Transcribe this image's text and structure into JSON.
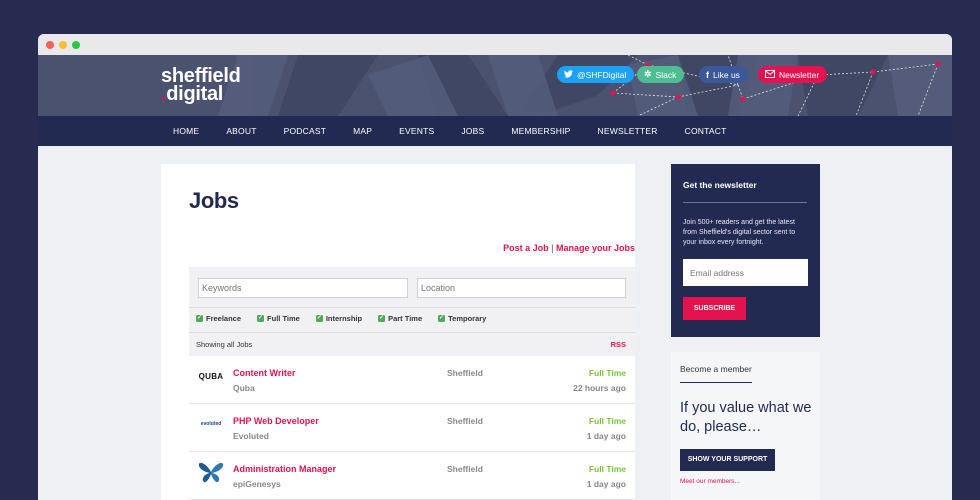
{
  "colors": {
    "navy": "#232a52",
    "brand_red": "#e4134f",
    "twitter_blue": "#1da1f2",
    "slack_green": "#4ebe92",
    "facebook_blue": "#3b5998",
    "full_time_green": "#78c432",
    "checkbox_green": "#52a95a"
  },
  "window_controls": [
    {
      "name": "close",
      "color": "#ff5f57"
    },
    {
      "name": "minimize",
      "color": "#febc2e"
    },
    {
      "name": "maximize",
      "color": "#28c840"
    }
  ],
  "header": {
    "logo_line1": "sheffield",
    "logo_dot": ".",
    "logo_line2": "digital",
    "social": {
      "twitter": {
        "icon": "twitter-bird-icon",
        "label": "@SHFDigital"
      },
      "slack": {
        "icon": "slack-icon",
        "label": "Slack"
      },
      "facebook": {
        "icon": "facebook-icon",
        "label": "Like us"
      },
      "newsletter": {
        "icon": "mail-icon",
        "label": "Newsletter"
      }
    }
  },
  "nav": {
    "items": [
      "HOME",
      "ABOUT",
      "PODCAST",
      "MAP",
      "EVENTS",
      "JOBS",
      "MEMBERSHIP",
      "NEWSLETTER",
      "CONTACT"
    ]
  },
  "main": {
    "title": "Jobs",
    "post_job": "Post a Job",
    "separator": "|",
    "manage_jobs": "Manage your Jobs",
    "keywords_placeholder": "Keywords",
    "location_placeholder": "Location",
    "job_types": [
      "Freelance",
      "Full Time",
      "Internship",
      "Part Time",
      "Temporary"
    ],
    "showing": "Showing all Jobs",
    "rss": "RSS",
    "jobs": [
      {
        "title": "Content Writer",
        "company": "Quba",
        "location": "Sheffield",
        "type": "Full Time",
        "date": "22 hours ago",
        "logo_text": "QUBA"
      },
      {
        "title": "PHP Web Developer",
        "company": "Evoluted",
        "location": "Sheffield",
        "type": "Full Time",
        "date": "1 day ago",
        "logo_text": "evoluted"
      },
      {
        "title": "Administration Manager",
        "company": "epiGenesys",
        "location": "Sheffield",
        "type": "Full Time",
        "date": "1 day ago",
        "logo_text": ""
      }
    ]
  },
  "newsletter_box": {
    "heading": "Get the newsletter",
    "text": "Join 500+ readers and get the latest from Sheffield's digital sector sent to your inbox every fortnight.",
    "email_placeholder": "Email address",
    "subscribe": "SUBSCRIBE"
  },
  "member_box": {
    "heading": "Become a member",
    "pitch": "If you value what we do, please…",
    "support": "SHOW YOUR SUPPORT",
    "meet": "Meet our members..."
  }
}
